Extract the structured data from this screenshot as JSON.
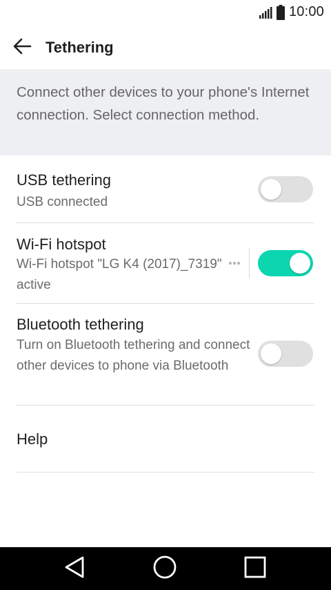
{
  "status_bar": {
    "time": "10:00",
    "icons": [
      "signal-icon",
      "battery-icon"
    ]
  },
  "app_bar": {
    "title": "Tethering",
    "back_icon": "arrow-left-icon"
  },
  "description": "Connect other devices to your phone's Internet connection. Select connection method.",
  "items": [
    {
      "title": "USB tethering",
      "subtitle": "USB connected",
      "toggle": false
    },
    {
      "title": "Wi-Fi hotspot",
      "subtitle": "Wi-Fi hotspot \"LG K4 (2017)_7319\" active",
      "toggle": true
    },
    {
      "title": "Bluetooth tethering",
      "subtitle": "Turn on Bluetooth tethering and connect other devices to phone via Bluetooth",
      "toggle": false
    },
    {
      "title": "Help"
    }
  ],
  "nav_bar": {
    "icons": [
      "triangle-back-icon",
      "circle-home-icon",
      "square-recents-icon"
    ]
  },
  "colors": {
    "accent": "#0bd6b0",
    "description_bg": "#eeeff3",
    "toggle_off": "#e0e0e0"
  }
}
